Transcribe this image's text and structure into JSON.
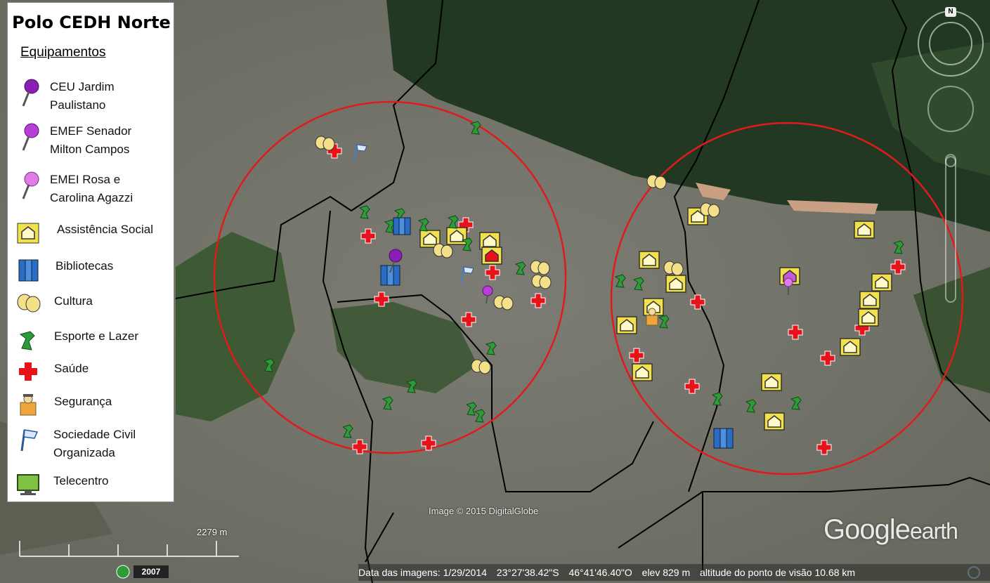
{
  "legend": {
    "title": "Polo CEDH Norte",
    "subtitle": "Equipamentos",
    "items": [
      {
        "label": "CEU Jardim\nPaulistano",
        "icon": "purple-pushpin-icon"
      },
      {
        "label": "EMEF Senador\nMilton Campos",
        "icon": "magenta-pushpin-icon"
      },
      {
        "label": "EMEI Rosa e\nCarolina Agazzi",
        "icon": "pink-pushpin-icon"
      },
      {
        "label": "Assistência Social",
        "icon": "house-icon"
      },
      {
        "label": "Bibliotecas",
        "icon": "books-icon"
      },
      {
        "label": "Cultura",
        "icon": "theater-masks-icon"
      },
      {
        "label": "Esporte e Lazer",
        "icon": "sport-runner-icon"
      },
      {
        "label": "Saúde",
        "icon": "red-cross-icon"
      },
      {
        "label": "Segurança",
        "icon": "security-guard-icon"
      },
      {
        "label": "Sociedade Civil\nOrganizada",
        "icon": "flag-icon"
      },
      {
        "label": "Telecentro",
        "icon": "computer-monitor-icon"
      }
    ]
  },
  "map": {
    "imagery_year": "2007",
    "scale_label": "2279 m",
    "credit": "Image © 2015 DigitalGlobe",
    "brand_google": "Google",
    "brand_earth": "earth",
    "north_label": "N",
    "circle_color": "#e01b1b",
    "boundary_color": "#000000"
  },
  "status": {
    "date": "Data das imagens: 1/29/2014",
    "lat": "23°27'38.42\"S",
    "lon": "46°41'46.40\"O",
    "elev": "elev   829 m",
    "altitude": "altitude do ponto de visão  10.68 km"
  }
}
